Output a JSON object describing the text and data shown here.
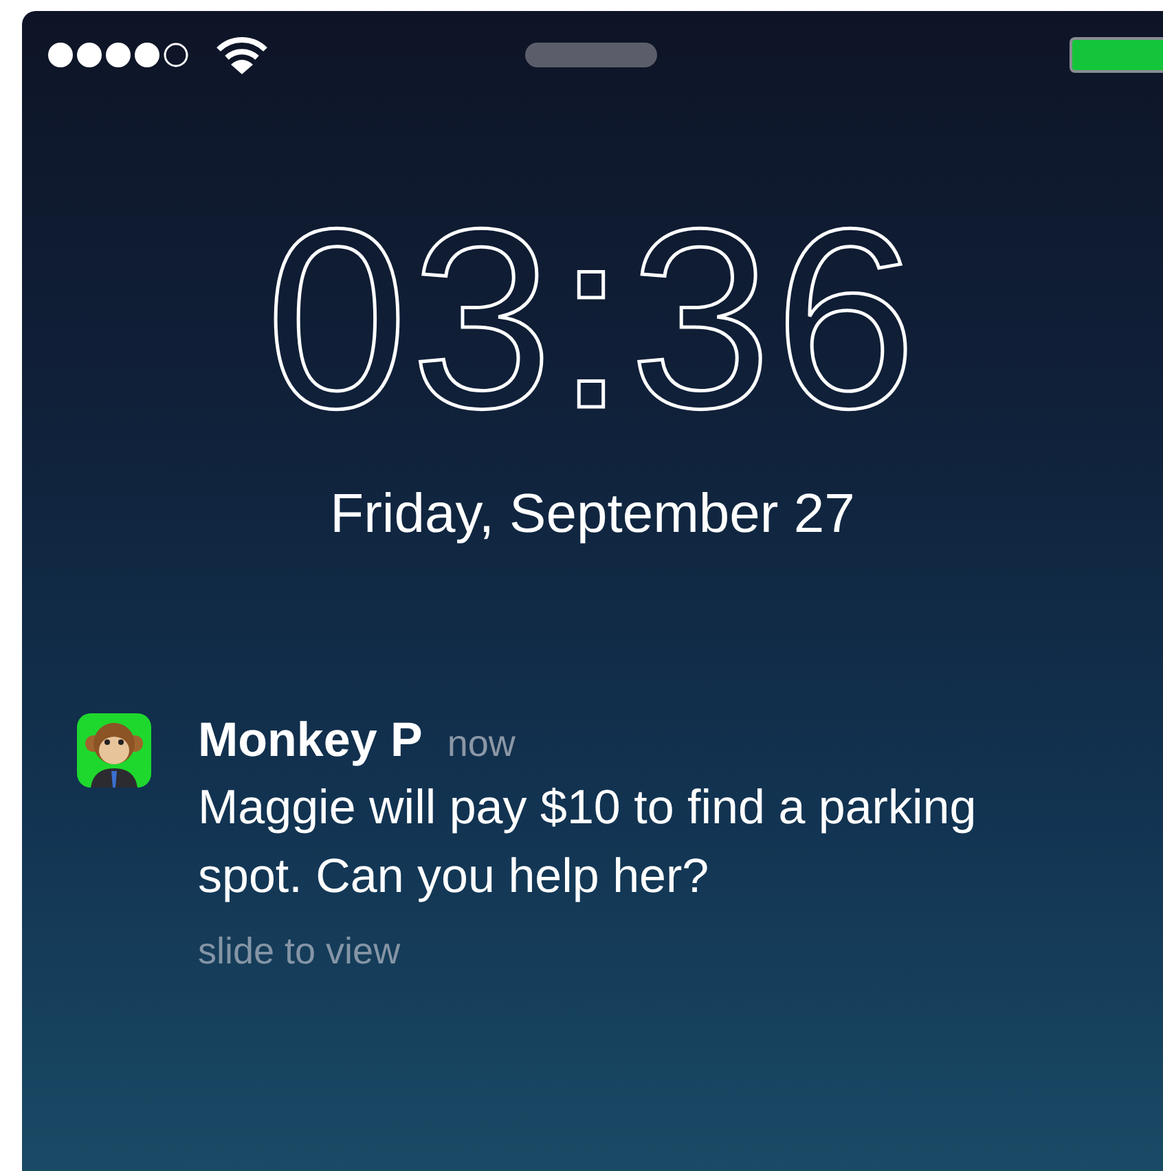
{
  "lock_screen": {
    "time": "03:36",
    "date": "Friday, September 27"
  },
  "notification": {
    "app_name": "Monkey P",
    "time": "now",
    "message": "Maggie will pay $10 to find a parking spot. Can you help her?",
    "hint": "slide to view"
  }
}
